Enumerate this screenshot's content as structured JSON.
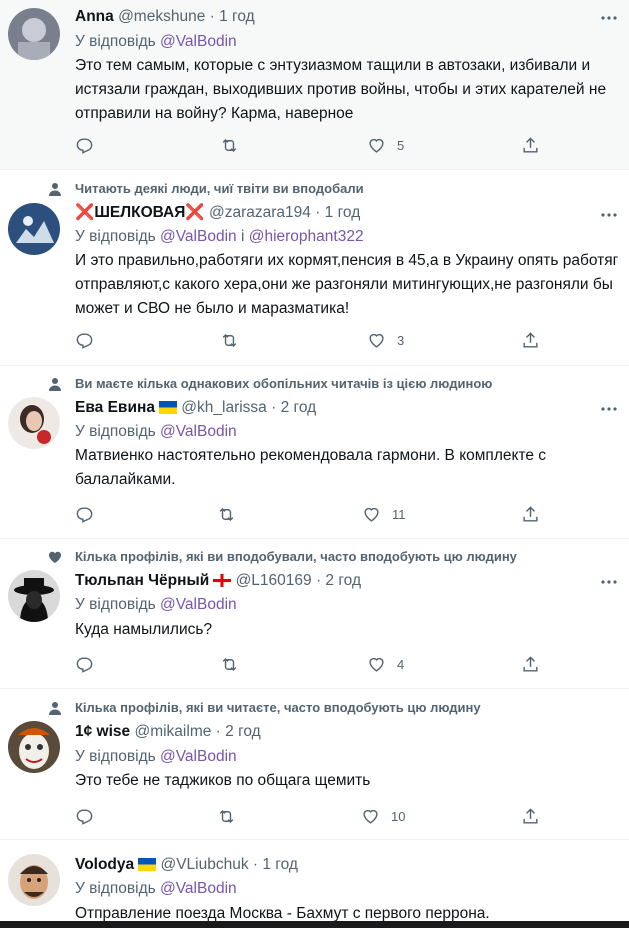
{
  "reply_prefix": "У відповідь",
  "reply_and": "і",
  "tweets": [
    {
      "name": "Anna",
      "handle": "@mekshune",
      "time": "· 1 год",
      "reply_to": [
        "@ValBodin"
      ],
      "text": "Это тем самым, которые с энтузиазмом тащили в автозаки, избивали и истязали граждан, выходивших против войны, чтобы и этих карателей не отправили на войну? Карма, наверное",
      "likes": "5",
      "highlighted": true
    },
    {
      "social": "Читають деякі люди, чиї твіти ви вподобали",
      "social_icon": "person-icon",
      "name_prefix_emoji": "❌",
      "name": "ШЕЛКОВАЯ",
      "name_suffix_emoji": "❌",
      "handle": "@zarazara194",
      "time": "· 1 год",
      "reply_to": [
        "@ValBodin",
        "@hierophant322"
      ],
      "text": "И это правильно,работяги их кормят,пенсия в 45,а в Украину опять работяг отправляют,с какого хера,они же разгоняли митингующих,не разгоняли бы может и СВО не было и маразматика!",
      "likes": "3"
    },
    {
      "social": "Ви маєте кілька однакових обопільних читачів із цією людиною",
      "social_icon": "person-icon",
      "name": "Ева Евина",
      "flag": "ukraine-flag",
      "handle": "@kh_larissa",
      "time": "· 2 год",
      "reply_to": [
        "@ValBodin"
      ],
      "text": "Матвиенко настоятельно рекомендовала гармони. В комплекте с балалайками.",
      "likes": "11"
    },
    {
      "social": "Кілька профілів, які ви вподобували, часто вподобують цю людину",
      "social_icon": "heart-icon",
      "name": "Тюльпан Чёрный",
      "flag": "georgia-flag",
      "handle": "@L160169",
      "time": "· 2 год",
      "reply_to": [
        "@ValBodin"
      ],
      "text": "Куда намылились?",
      "likes": "4"
    },
    {
      "social": "Кілька профілів, які ви читаєте, часто вподобують цю людину",
      "social_icon": "person-icon",
      "name": "1¢ wise",
      "handle": "@mikailme",
      "time": "· 2 год",
      "reply_to": [
        "@ValBodin"
      ],
      "text": "Это тебе не таджиков по общага щемить",
      "likes": "10"
    },
    {
      "name": "Volodya",
      "flag": "ukraine-flag",
      "handle": "@VLiubchuk",
      "time": "· 1 год",
      "reply_to": [
        "@ValBodin"
      ],
      "text": "Отправление поезда Москва - Бахмут с первого перрона."
    }
  ],
  "colors": {
    "link": "#7856a8",
    "muted": "#536471",
    "highlight_bg": "#f7f9f9"
  }
}
